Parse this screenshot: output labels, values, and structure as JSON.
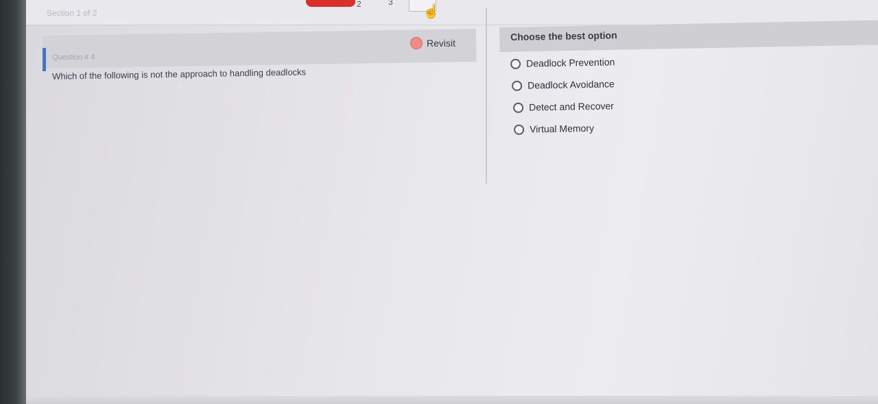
{
  "header": {
    "section_label": "Section 1 of 2",
    "nav_numbers": [
      "2",
      "3"
    ]
  },
  "question": {
    "number_label": "Question # 4",
    "revisit_label": "Revisit",
    "text": "Which of the following is not the approach to handling deadlocks"
  },
  "answers": {
    "header": "Choose the best option",
    "options": [
      {
        "label": "Deadlock Prevention"
      },
      {
        "label": "Deadlock Avoidance"
      },
      {
        "label": "Detect and Recover"
      },
      {
        "label": "Virtual Memory"
      }
    ]
  },
  "colors": {
    "active_nav": "#d9302b",
    "accent": "#4c74b6",
    "revisit_icon": "#ef8c86"
  },
  "icons": {
    "revisit": "revisit-icon",
    "cursor": "hand-cursor-icon"
  }
}
